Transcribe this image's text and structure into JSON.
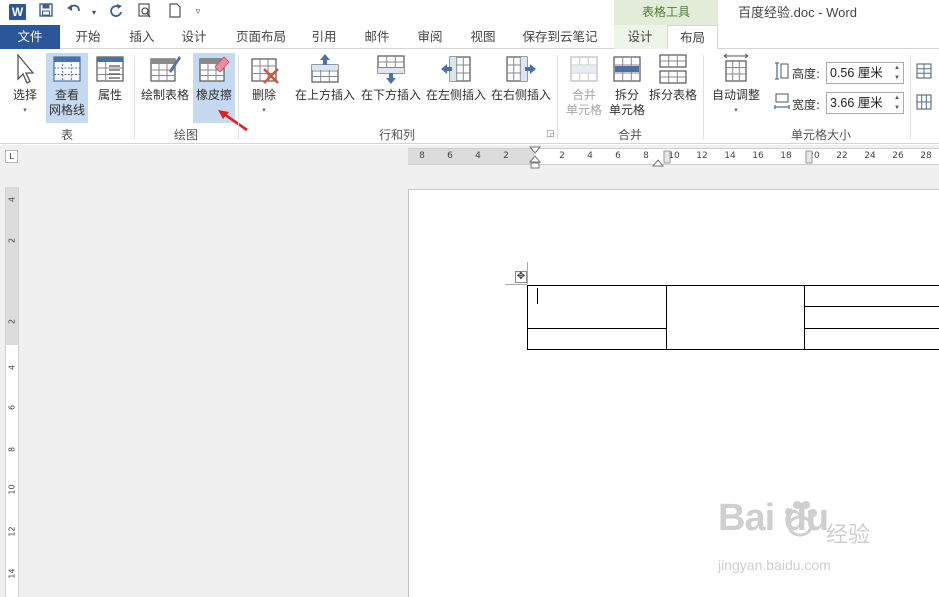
{
  "titlebar": {
    "app_icon": "W",
    "contextual_group": "表格工具",
    "doc_title": "百度经验.doc - Word",
    "qat": [
      "save-icon",
      "undo-icon",
      "redo-icon",
      "print-preview-icon",
      "new-doc-icon",
      "customize-icon"
    ]
  },
  "tabs": {
    "file": "文件",
    "home": "开始",
    "insert": "插入",
    "design": "设计",
    "page_layout": "页面布局",
    "references": "引用",
    "mailings": "邮件",
    "review": "审阅",
    "view": "视图",
    "save_cloud": "保存到云笔记",
    "table_design": "设计",
    "table_layout": "布局"
  },
  "ribbon": {
    "select": "选择",
    "view_gridlines_1": "查看",
    "view_gridlines_2": "网格线",
    "properties": "属性",
    "draw_table": "绘制表格",
    "eraser": "橡皮擦",
    "delete": "删除",
    "insert_above": "在上方插入",
    "insert_below": "在下方插入",
    "insert_left": "在左侧插入",
    "insert_right": "在右侧插入",
    "merge_cells_1": "合并",
    "merge_cells_2": "单元格",
    "split_cells_1": "拆分",
    "split_cells_2": "单元格",
    "split_table": "拆分表格",
    "autofit": "自动调整",
    "height_label": "高度:",
    "height_value": "0.56 厘米",
    "width_label": "宽度:",
    "width_value": "3.66 厘米",
    "groups": {
      "table": "表",
      "draw": "绘图",
      "rows_cols": "行和列",
      "merge": "合并",
      "cell_size": "单元格大小"
    }
  },
  "ruler": {
    "corner": "L",
    "h_ticks": [
      "8",
      "6",
      "4",
      "2",
      "2",
      "4",
      "6",
      "8",
      "10",
      "12",
      "14",
      "16",
      "18",
      "20",
      "22",
      "24",
      "26",
      "28"
    ],
    "v_ticks": [
      "4",
      "2",
      "2",
      "4",
      "6",
      "8",
      "10",
      "12",
      "14"
    ]
  },
  "watermark": {
    "logo": "Bai du",
    "text": "经验",
    "url": "jingyan.baidu.com"
  },
  "colors": {
    "word_blue": "#2b579a",
    "contextual_green": "#4e7e2f",
    "active_button": "#c5d9f1",
    "annotation_arrow": "#e02020"
  }
}
